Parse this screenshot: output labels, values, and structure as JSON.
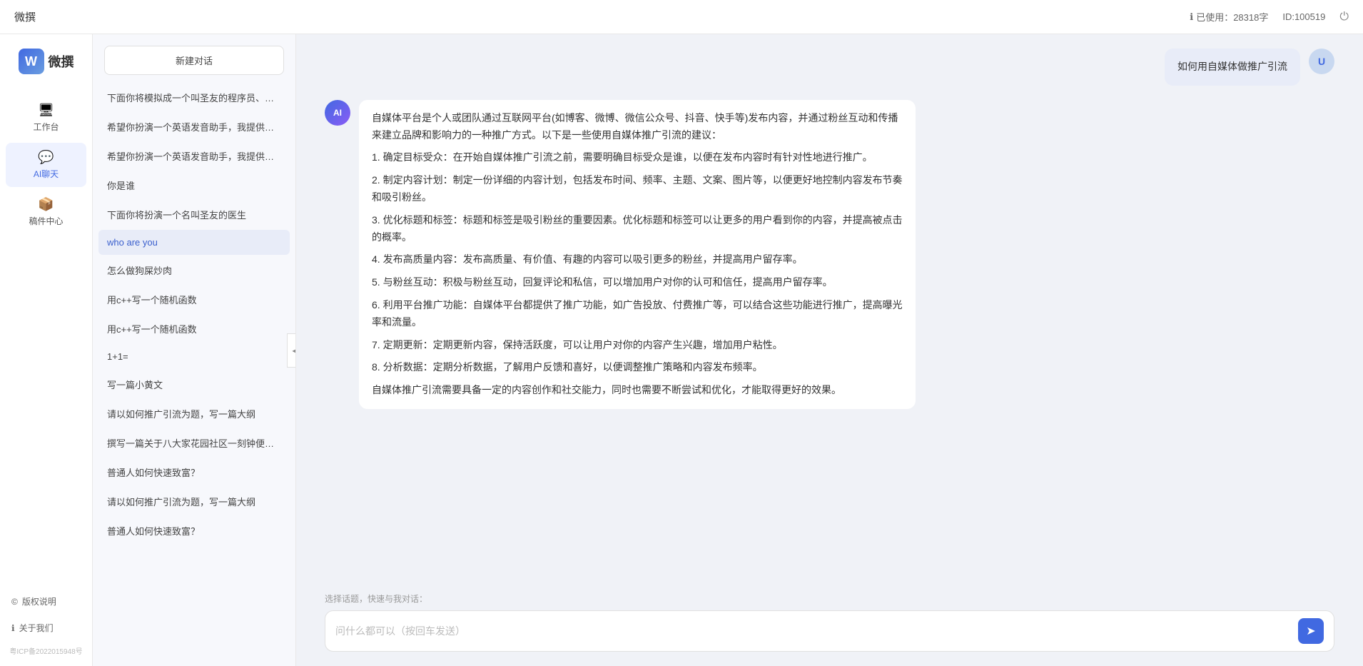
{
  "topbar": {
    "title": "微撰",
    "usage_label": "已使用：28318字",
    "usage_icon": "ℹ",
    "id_label": "ID:100519",
    "power_icon": "⏻"
  },
  "logo": {
    "w_letter": "W",
    "brand_name": "微撰"
  },
  "nav": {
    "items": [
      {
        "id": "workbench",
        "icon": "🖥",
        "label": "工作台"
      },
      {
        "id": "ai-chat",
        "icon": "💬",
        "label": "AI聊天"
      },
      {
        "id": "drafts",
        "icon": "📦",
        "label": "稿件中心"
      }
    ]
  },
  "sidebar_bottom": {
    "copyright_label": "版权说明",
    "copyright_icon": "©",
    "about_label": "关于我们",
    "about_icon": "ℹ",
    "icp": "粤ICP备2022015948号"
  },
  "chat_sidebar": {
    "new_chat_label": "新建对话",
    "history": [
      {
        "id": 1,
        "text": "下面你将模拟成一个叫圣友的程序员、我说..."
      },
      {
        "id": 2,
        "text": "希望你扮演一个英语发音助手，我提供给你..."
      },
      {
        "id": 3,
        "text": "希望你扮演一个英语发音助手，我提供给你..."
      },
      {
        "id": 4,
        "text": "你是谁"
      },
      {
        "id": 5,
        "text": "下面你将扮演一个名叫圣友的医生"
      },
      {
        "id": 6,
        "text": "who are you"
      },
      {
        "id": 7,
        "text": "怎么做狗屎炒肉"
      },
      {
        "id": 8,
        "text": "用c++写一个随机函数"
      },
      {
        "id": 9,
        "text": "用c++写一个随机函数"
      },
      {
        "id": 10,
        "text": "1+1="
      },
      {
        "id": 11,
        "text": "写一篇小黄文"
      },
      {
        "id": 12,
        "text": "请以如何推广引流为题，写一篇大纲"
      },
      {
        "id": 13,
        "text": "撰写一篇关于八大家花园社区一刻钟便民生..."
      },
      {
        "id": 14,
        "text": "普通人如何快速致富？"
      },
      {
        "id": 15,
        "text": "请以如何推广引流为题，写一篇大纲"
      },
      {
        "id": 16,
        "text": "普通人如何快速致富？"
      }
    ]
  },
  "messages": [
    {
      "role": "user",
      "avatar_type": "user",
      "avatar_text": "U",
      "content": "如何用自媒体做推广引流"
    },
    {
      "role": "ai",
      "avatar_type": "ai",
      "avatar_text": "AI",
      "content_paragraphs": [
        "自媒体平台是个人或团队通过互联网平台(如博客、微博、微信公众号、抖音、快手等)发布内容，并通过粉丝互动和传播来建立品牌和影响力的一种推广方式。以下是一些使用自媒体推广引流的建议：",
        "1. 确定目标受众：在开始自媒体推广引流之前，需要明确目标受众是谁，以便在发布内容时有针对性地进行推广。",
        "2. 制定内容计划：制定一份详细的内容计划，包括发布时间、频率、主题、文案、图片等，以便更好地控制内容发布节奏和吸引粉丝。",
        "3. 优化标题和标签：标题和标签是吸引粉丝的重要因素。优化标题和标签可以让更多的用户看到你的内容，并提高被点击的概率。",
        "4. 发布高质量内容：发布高质量、有价值、有趣的内容可以吸引更多的粉丝，并提高用户留存率。",
        "5. 与粉丝互动：积极与粉丝互动，回复评论和私信，可以增加用户对你的认可和信任，提高用户留存率。",
        "6. 利用平台推广功能：自媒体平台都提供了推广功能，如广告投放、付费推广等，可以结合这些功能进行推广，提高曝光率和流量。",
        "7. 定期更新：定期更新内容，保持活跃度，可以让用户对你的内容产生兴趣，增加用户粘性。",
        "8. 分析数据：定期分析数据，了解用户反馈和喜好，以便调整推广策略和内容发布频率。",
        "自媒体推广引流需要具备一定的内容创作和社交能力，同时也需要不断尝试和优化，才能取得更好的效果。"
      ]
    }
  ],
  "input": {
    "quick_topic_label": "选择话题，快速与我对话：",
    "placeholder": "问什么都可以（按回车发送）",
    "send_icon": "➤"
  }
}
